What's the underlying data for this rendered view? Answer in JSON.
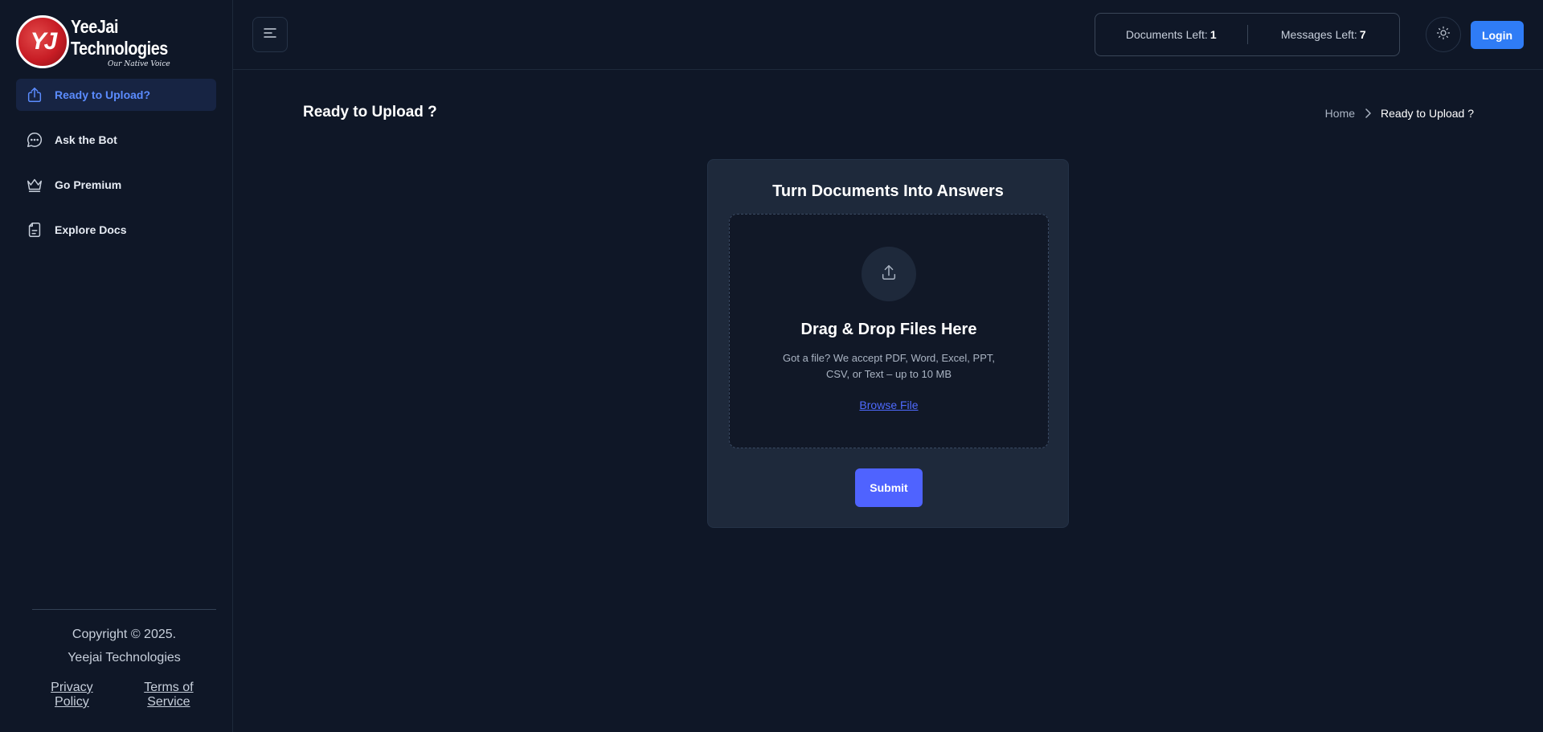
{
  "brand": {
    "logo_initials": "YJ",
    "name": "YeeJai Technologies",
    "tagline": "Our Native Voice",
    "logo_color": "#c81d25"
  },
  "sidebar": {
    "items": [
      {
        "label": "Ready to Upload?",
        "icon": "upload-icon",
        "active": true
      },
      {
        "label": "Ask the Bot",
        "icon": "chat-bubble-icon",
        "active": false
      },
      {
        "label": "Go Premium",
        "icon": "crown-icon",
        "active": false
      },
      {
        "label": "Explore Docs",
        "icon": "document-icon",
        "active": false
      }
    ],
    "footer": {
      "copyright_line1": "Copyright © 2025.",
      "copyright_line2": "Yeejai Technologies",
      "privacy_label": "Privacy Policy",
      "terms_label": "Terms of Service"
    }
  },
  "header": {
    "menu_icon": "menu-icon",
    "documents_left_label": "Documents Left:",
    "documents_left_value": "1",
    "messages_left_label": "Messages Left:",
    "messages_left_value": "7",
    "theme_icon": "sun-icon",
    "login_label": "Login"
  },
  "page": {
    "title": "Ready to Upload ?",
    "breadcrumb": {
      "home": "Home",
      "current": "Ready to Upload ?"
    }
  },
  "upload_card": {
    "title": "Turn Documents Into Answers",
    "dropzone_title": "Drag & Drop Files Here",
    "dropzone_description": "Got a file? We accept PDF, Word, Excel, PPT, CSV, or Text – up to 10 MB",
    "browse_label": "Browse File",
    "submit_label": "Submit"
  },
  "colors": {
    "background": "#0f1727",
    "card": "#1e293b",
    "accent": "#4f63ff",
    "login_button": "#2f7cf6",
    "active_nav_text": "#5b8cff"
  }
}
